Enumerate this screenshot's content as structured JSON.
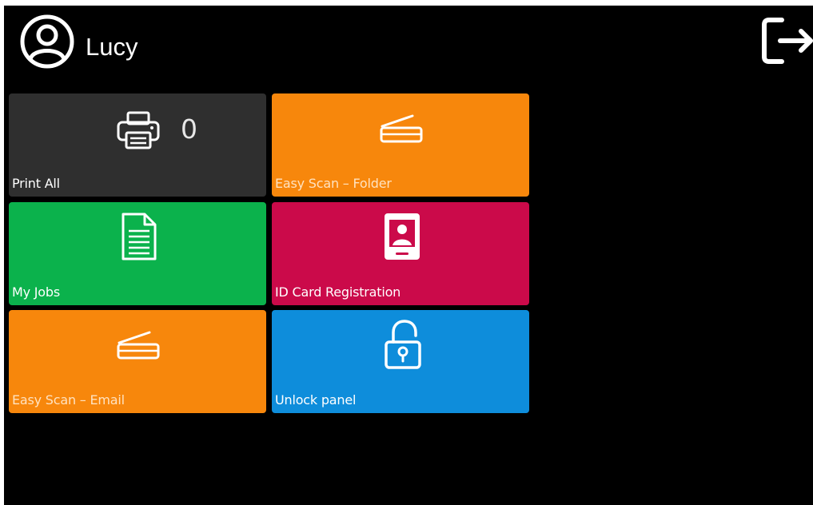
{
  "user": {
    "name": "Lucy",
    "icon": "user-circle-icon"
  },
  "header": {
    "logout_icon": "logout-icon"
  },
  "tiles": [
    {
      "label": "Print All",
      "icon": "printer-icon",
      "count": "0",
      "color": "#2f2f2f"
    },
    {
      "label": "Easy Scan – Folder",
      "icon": "scanner-icon",
      "color": "#f7870c"
    },
    {
      "label": "My Jobs",
      "icon": "document-icon",
      "color": "#0bb24c"
    },
    {
      "label": "ID Card Registration",
      "icon": "id-card-icon",
      "color": "#cb0a4a"
    },
    {
      "label": "Easy Scan – Email",
      "icon": "scanner-icon",
      "color": "#f7870c"
    },
    {
      "label": "Unlock panel",
      "icon": "unlock-icon",
      "color": "#0e8ddb"
    }
  ]
}
